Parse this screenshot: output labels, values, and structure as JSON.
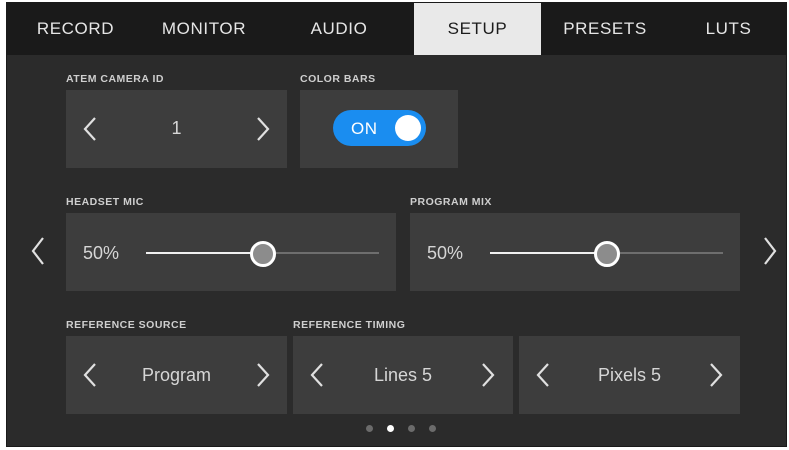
{
  "tabs": [
    {
      "label": "RECORD",
      "active": false
    },
    {
      "label": "MONITOR",
      "active": false
    },
    {
      "label": "AUDIO",
      "active": false
    },
    {
      "label": "SETUP",
      "active": true
    },
    {
      "label": "PRESETS",
      "active": false
    },
    {
      "label": "LUTS",
      "active": false
    }
  ],
  "atem_camera_id": {
    "label": "ATEM CAMERA ID",
    "value": "1"
  },
  "color_bars": {
    "label": "COLOR BARS",
    "toggle_text": "ON",
    "enabled": true
  },
  "headset_mic": {
    "label": "HEADSET MIC",
    "value_text": "50%",
    "level": 0.5
  },
  "program_mix": {
    "label": "PROGRAM MIX",
    "value_text": "50%",
    "level": 0.5
  },
  "reference_source": {
    "label": "REFERENCE SOURCE",
    "value": "Program"
  },
  "reference_timing": {
    "label": "REFERENCE TIMING",
    "lines_value": "Lines 5",
    "pixels_value": "Pixels 5"
  },
  "pagination": {
    "total": 4,
    "current": 2
  },
  "colors": {
    "background": "#2b2b2b",
    "tab_bar": "#1a1a1a",
    "active_tab": "#e9e9e9",
    "box": "#3d3d3d",
    "toggle_on": "#1a8df0"
  },
  "icons": {
    "chevron_left": "chevron-left-icon",
    "chevron_right": "chevron-right-icon"
  }
}
